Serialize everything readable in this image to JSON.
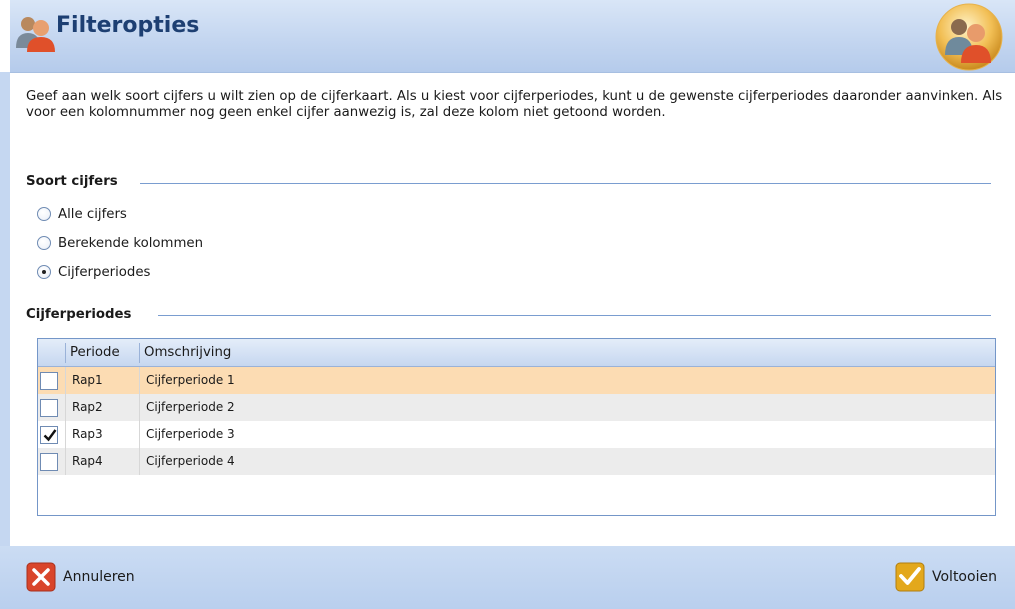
{
  "window": {
    "title": "Filteropties"
  },
  "intro_text": "Geef aan welk soort cijfers u wilt zien op de cijferkaart. Als u kiest voor cijferperiodes, kunt u de gewenste cijferperiodes daaronder aanvinken.  Als voor een kolomnummer nog geen enkel cijfer aanwezig is, zal deze kolom niet getoond worden.",
  "soort_cijfers": {
    "title": "Soort cijfers",
    "options": [
      {
        "label": "Alle cijfers",
        "checked": false
      },
      {
        "label": "Berekende kolommen",
        "checked": false
      },
      {
        "label": "Cijferperiodes",
        "checked": true
      }
    ]
  },
  "cijferperiodes": {
    "title": "Cijferperiodes",
    "columns": [
      "Periode",
      "Omschrijving"
    ],
    "rows": [
      {
        "periode": "Rap1",
        "omschrijving": "Cijferperiode 1",
        "checked": false,
        "selected": true
      },
      {
        "periode": "Rap2",
        "omschrijving": "Cijferperiode 2",
        "checked": false,
        "selected": false
      },
      {
        "periode": "Rap3",
        "omschrijving": "Cijferperiode 3",
        "checked": true,
        "selected": false
      },
      {
        "periode": "Rap4",
        "omschrijving": "Cijferperiode 4",
        "checked": false,
        "selected": false
      }
    ]
  },
  "footer": {
    "cancel_label": "Annuleren",
    "ok_label": "Voltooien"
  },
  "colors": {
    "title": "#1d3f72",
    "selected_row": "#fcdcb3",
    "alt_row": "#ececec",
    "cancel_icon": "#d9452b",
    "ok_icon": "#e3a81c"
  },
  "icons": {
    "title": "users-icon",
    "corner": "users-badge-icon",
    "cancel": "close-icon",
    "ok": "checkmark-icon"
  }
}
